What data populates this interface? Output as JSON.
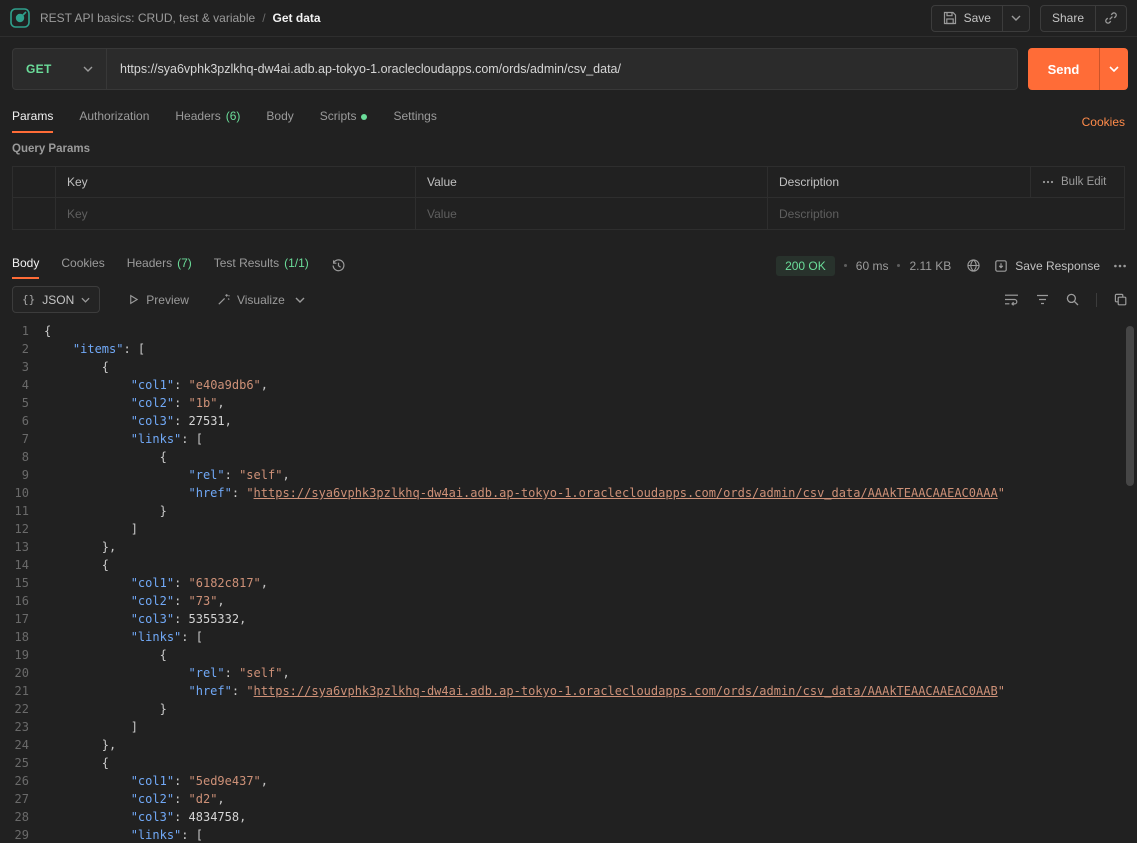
{
  "topbar": {
    "breadcrumb_collection": "REST API basics: CRUD, test & variable",
    "breadcrumb_separator": "/",
    "breadcrumb_current": "Get data",
    "save_label": "Save",
    "share_label": "Share"
  },
  "request": {
    "method": "GET",
    "url": "https://sya6vphk3pzlkhq-dw4ai.adb.ap-tokyo-1.oraclecloudapps.com/ords/admin/csv_data/",
    "send_label": "Send"
  },
  "request_tabs": {
    "params": "Params",
    "authorization": "Authorization",
    "headers": "Headers",
    "headers_count": "(6)",
    "body": "Body",
    "scripts": "Scripts",
    "settings": "Settings",
    "cookies_link": "Cookies"
  },
  "params_section": {
    "title": "Query Params",
    "col_key": "Key",
    "col_value": "Value",
    "col_description": "Description",
    "bulk_edit": "Bulk Edit",
    "ph_key": "Key",
    "ph_value": "Value",
    "ph_description": "Description"
  },
  "response": {
    "tab_body": "Body",
    "tab_cookies": "Cookies",
    "tab_headers": "Headers",
    "tab_headers_count": "(7)",
    "tab_tests": "Test Results",
    "tab_tests_count": "(1/1)",
    "status": "200 OK",
    "time": "60 ms",
    "size": "2.11 KB",
    "save_response": "Save Response",
    "format_label": "JSON",
    "preview": "Preview",
    "visualize": "Visualize"
  },
  "code": {
    "lines": [
      "{",
      "    \"items\": [",
      "        {",
      "            \"col1\": \"e40a9db6\",",
      "            \"col2\": \"1b\",",
      "            \"col3\": 27531,",
      "            \"links\": [",
      "                {",
      "                    \"rel\": \"self\",",
      "                    \"href\": \"https://sya6vphk3pzlkhq-dw4ai.adb.ap-tokyo-1.oraclecloudapps.com/ords/admin/csv_data/AAAkTEAACAAEAC0AAA\"",
      "                }",
      "            ]",
      "        },",
      "        {",
      "            \"col1\": \"6182c817\",",
      "            \"col2\": \"73\",",
      "            \"col3\": 5355332,",
      "            \"links\": [",
      "                {",
      "                    \"rel\": \"self\",",
      "                    \"href\": \"https://sya6vphk3pzlkhq-dw4ai.adb.ap-tokyo-1.oraclecloudapps.com/ords/admin/csv_data/AAAkTEAACAAEAC0AAB\"",
      "                }",
      "            ]",
      "        },",
      "        {",
      "            \"col1\": \"5ed9e437\",",
      "            \"col2\": \"d2\",",
      "            \"col3\": 4834758,",
      "            \"links\": ["
    ]
  }
}
